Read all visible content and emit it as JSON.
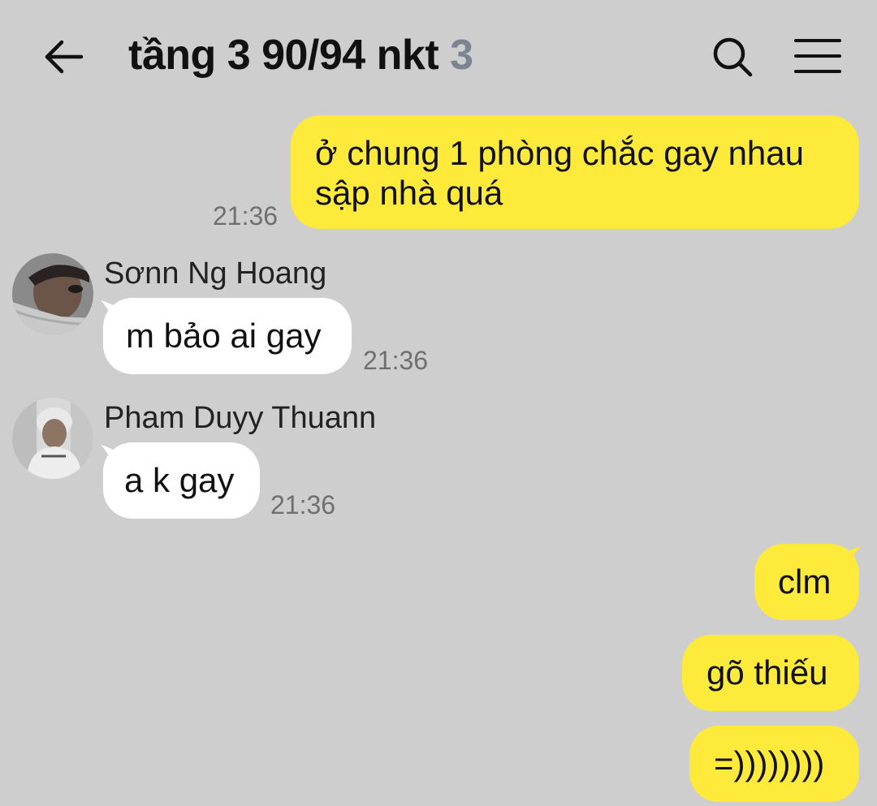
{
  "header": {
    "title": "tầng 3 90/94 nkt",
    "member_count": "3",
    "icons": {
      "back": "arrow-left-icon",
      "search": "search-icon",
      "menu": "hamburger-menu-icon"
    }
  },
  "colors": {
    "background": "#cecece",
    "my_bubble": "#fdea3b",
    "their_bubble": "#ffffff",
    "count_color": "#7b8490",
    "time_color": "#6f6f6f"
  },
  "messages": [
    {
      "sender": "me",
      "text_lines": [
        "ở chung 1 phòng chắc gay nhau",
        "sập nhà quá"
      ],
      "time": "21:36"
    },
    {
      "sender": "Sơnn Ng Hoang",
      "text": "m bảo ai gay",
      "time": "21:36"
    },
    {
      "sender": "Pham Duyy Thuann",
      "text": "a k gay",
      "time": "21:36"
    },
    {
      "sender": "me",
      "text": "clm"
    },
    {
      "sender": "me",
      "text": "gõ thiếu"
    },
    {
      "sender": "me",
      "text": "=))))))))"
    }
  ]
}
